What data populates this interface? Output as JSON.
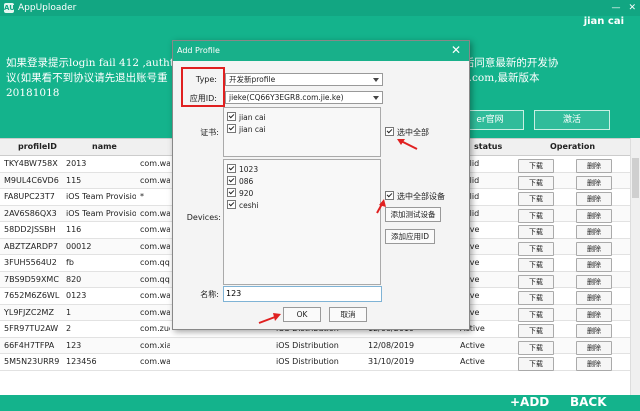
{
  "titlebar": {
    "app_title": "AppUploader",
    "logo_text": "AU",
    "min_icon": "minimize-icon",
    "close_icon": "close-icon",
    "min_glyph": "—",
    "close_glyph": "✕"
  },
  "banner": {
    "user": "jian cai",
    "notice_line1_left": "如果登录提示login fail 412 ,authtyp",
    "notice_line1_right": "pple.com/ 然后同意最新的开发协",
    "notice_line2_left": "议(如果看不到协议请先退出账号重",
    "notice_line2_right": "2611616@qq.com,最新版本",
    "notice_line3": "20181018",
    "button_website": "er官网",
    "button_activate": "激活"
  },
  "table": {
    "headers": {
      "profile_id": "profileID",
      "name": "name",
      "status": "status",
      "operation": "Operation"
    },
    "download_label": "下载",
    "delete_label": "删除",
    "rows": [
      {
        "id": "TKY4BW758X",
        "name": "2013",
        "bundle": "com.wang.",
        "type": "",
        "date": "",
        "status": "valid"
      },
      {
        "id": "M9UL4C6VD6",
        "name": "115",
        "bundle": "com.wang.",
        "type": "",
        "date": "",
        "status": "valid"
      },
      {
        "id": "FA8UPC23T7",
        "name": "iOS Team Provisioni...",
        "bundle": "*",
        "type": "",
        "date": "",
        "status": "valid"
      },
      {
        "id": "2AV6S86QX3",
        "name": "iOS Team Provisioni...",
        "bundle": "com.wang.",
        "type": "",
        "date": "",
        "status": "valid"
      },
      {
        "id": "58DD2JSSBH",
        "name": "116",
        "bundle": "com.wang.",
        "type": "",
        "date": "",
        "status": "ctive"
      },
      {
        "id": "ABZTZARDP7",
        "name": "00012",
        "bundle": "com.wang.",
        "type": "",
        "date": "",
        "status": "ctive"
      },
      {
        "id": "3FUH5564U2",
        "name": "fb",
        "bundle": "com.qq.jc",
        "type": "",
        "date": "",
        "status": "ctive"
      },
      {
        "id": "7BS9D59XMC",
        "name": "820",
        "bundle": "com.qq.jc",
        "type": "",
        "date": "",
        "status": "ctive"
      },
      {
        "id": "7652M6Z6WL",
        "name": "0123",
        "bundle": "com.wang.",
        "type": "",
        "date": "",
        "status": "ctive"
      },
      {
        "id": "YL9FJZC2MZ",
        "name": "1",
        "bundle": "com.wang.",
        "type": "",
        "date": "",
        "status": "ctive"
      },
      {
        "id": "5FR97TU2AW",
        "name": "2",
        "bundle": "com.zuojia.fenfen",
        "type": "iOS Distribution",
        "date": "12/08/2019",
        "status": "Active"
      },
      {
        "id": "66F4H7TFPA",
        "name": "123",
        "bundle": "com.xiao.tang",
        "type": "iOS Distribution",
        "date": "12/08/2019",
        "status": "Active"
      },
      {
        "id": "5M5N23URR9",
        "name": "123456",
        "bundle": "com.wang.le",
        "type": "iOS Distribution",
        "date": "31/10/2019",
        "status": "Active"
      }
    ]
  },
  "bottombar": {
    "add_label": "+ADD",
    "back_label": "BACK"
  },
  "dialog": {
    "title": "Add Profile",
    "close_glyph": "✕",
    "type_label": "Type:",
    "type_value": "开发新profile",
    "appid_label": "应用ID:",
    "appid_value": "jieke(CQ66Y3EGR8.com.jie.ke)",
    "cert_label": "证书:",
    "certificates": [
      "jian cai",
      "jian cai"
    ],
    "select_all_label": "选中全部",
    "devices_label": "Devices:",
    "devices": [
      "1023",
      "086",
      "920",
      "ceshi"
    ],
    "select_all_devices_label": "选中全部设备",
    "add_device_button": "添加测试设备",
    "add_app_button": "添加应用ID",
    "name_label": "名称:",
    "name_value": "123",
    "ok_button": "OK",
    "cancel_button": "取消"
  },
  "colors": {
    "accent": "#14b38c",
    "highlight_red": "#e02020"
  }
}
